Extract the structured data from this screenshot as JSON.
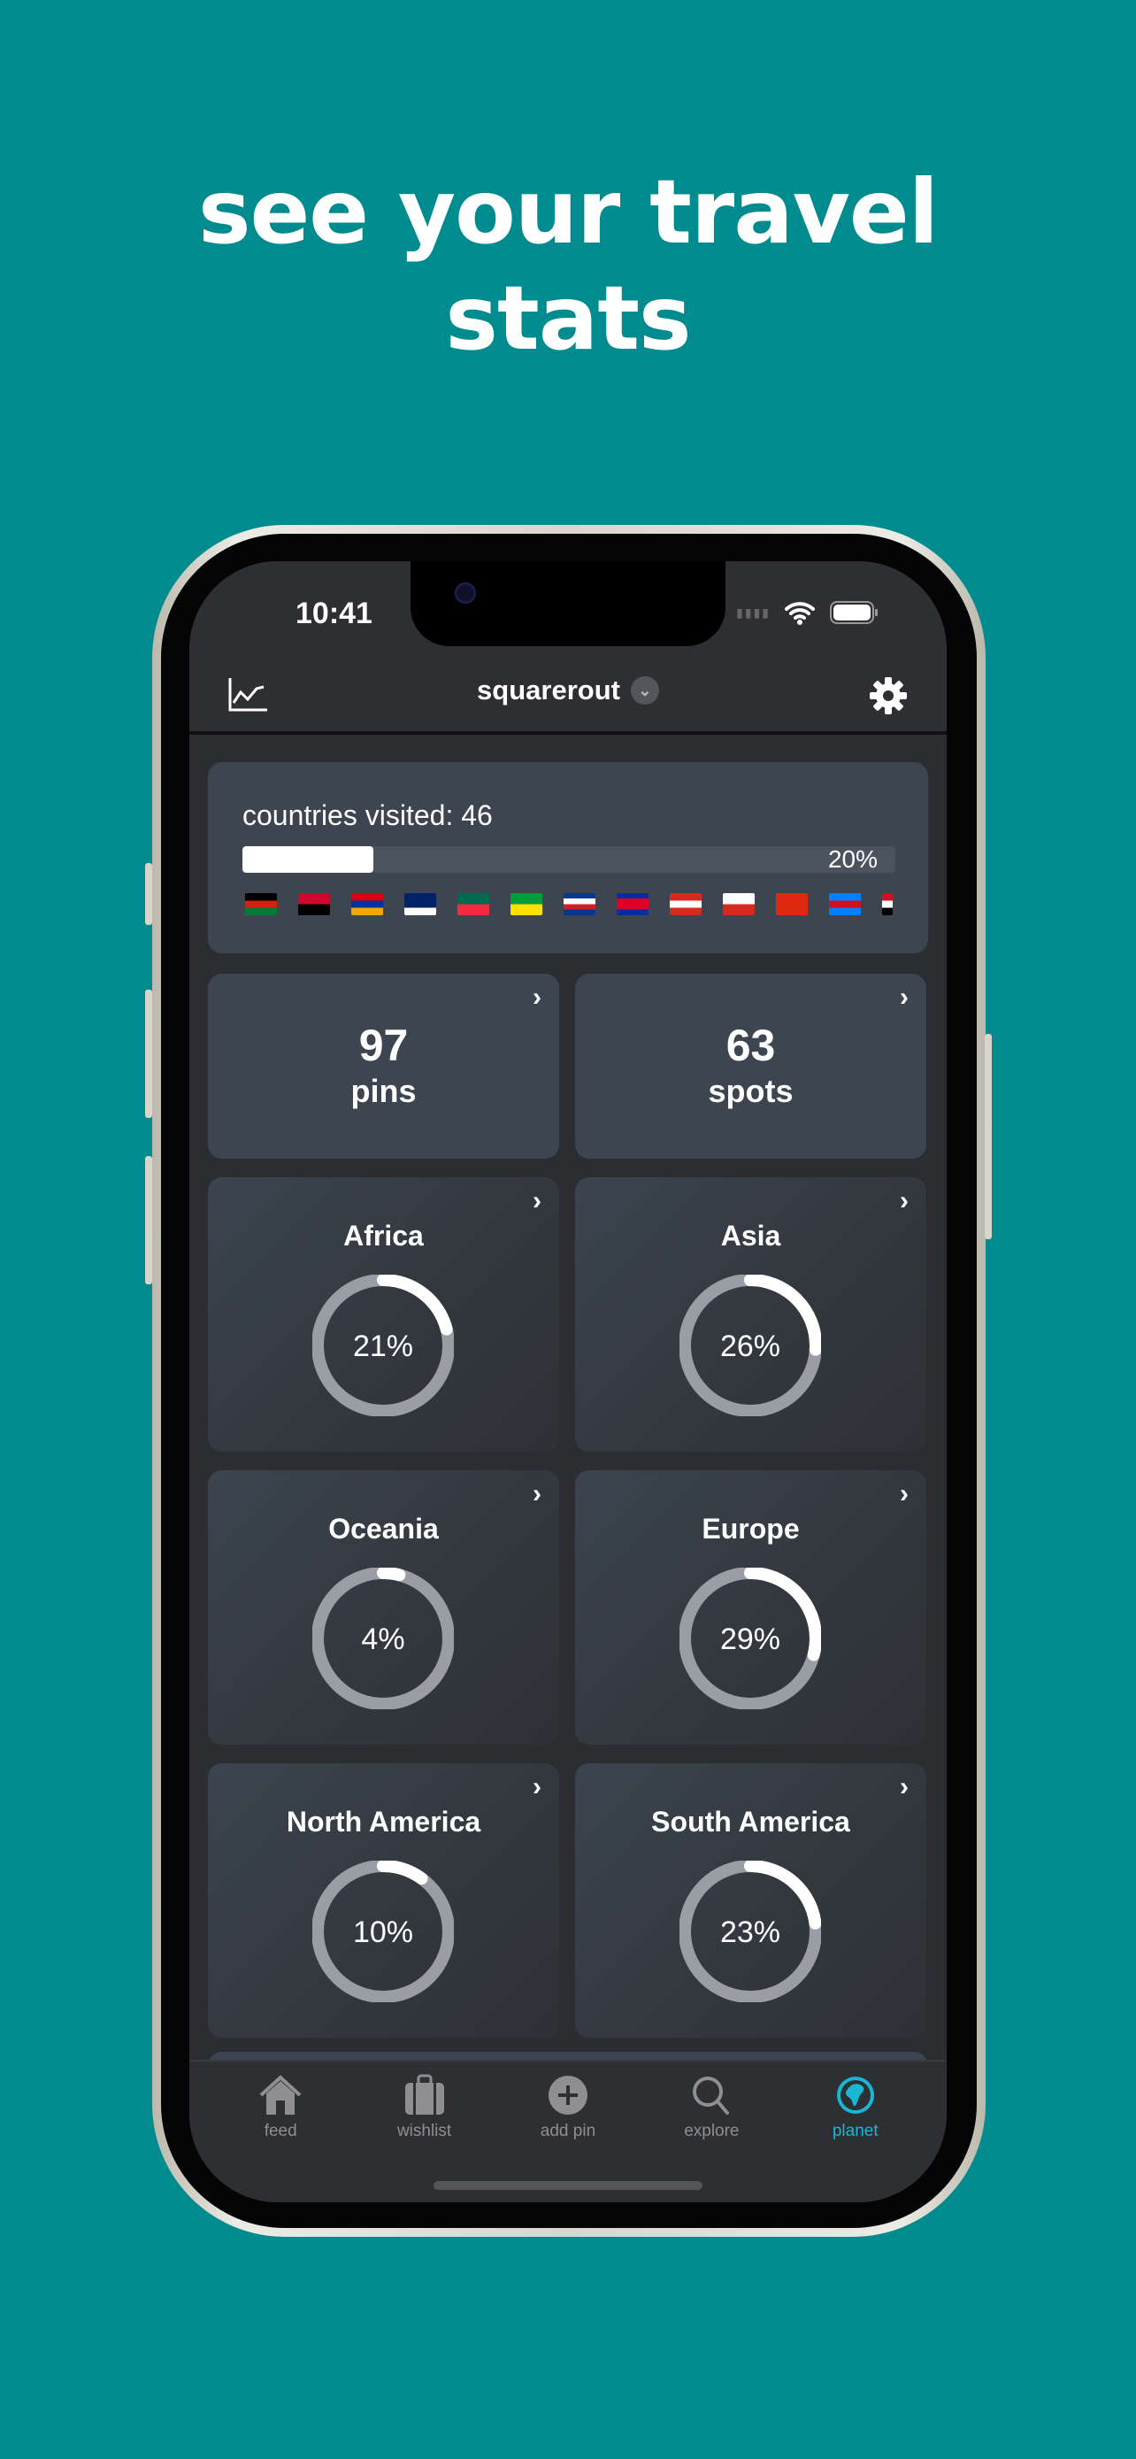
{
  "headline": [
    "see your travel",
    "stats"
  ],
  "status": {
    "time": "10:41"
  },
  "nav": {
    "title": "squarerout",
    "left_icon": "chart-line-icon",
    "right_icon": "gear-icon"
  },
  "countries": {
    "label": "countries visited: 46",
    "progress_percent": 20,
    "progress_label": "20%",
    "flags": [
      {
        "name": "afghanistan",
        "colors": [
          "#000",
          "#d32011",
          "#007a36"
        ]
      },
      {
        "name": "angola",
        "colors": [
          "#cc092f",
          "#000"
        ]
      },
      {
        "name": "armenia",
        "colors": [
          "#d90012",
          "#0033a0",
          "#f2a800"
        ]
      },
      {
        "name": "australia",
        "colors": [
          "#012169",
          "#012169",
          "#fff"
        ]
      },
      {
        "name": "bangladesh",
        "colors": [
          "#006a4e",
          "#f42a41"
        ]
      },
      {
        "name": "brazil",
        "colors": [
          "#009c3b",
          "#ffdf00"
        ]
      },
      {
        "name": "cape-verde",
        "colors": [
          "#003893",
          "#fff",
          "#cf2027",
          "#003893"
        ]
      },
      {
        "name": "cambodia",
        "colors": [
          "#032ea1",
          "#e00025",
          "#e00025",
          "#032ea1"
        ]
      },
      {
        "name": "canada",
        "colors": [
          "#d52b1e",
          "#fff",
          "#d52b1e"
        ]
      },
      {
        "name": "chile",
        "colors": [
          "#fff",
          "#d52b1e"
        ]
      },
      {
        "name": "china",
        "colors": [
          "#de2910",
          "#de2910"
        ]
      },
      {
        "name": "dr-congo",
        "colors": [
          "#007fff",
          "#ce1021",
          "#007fff"
        ]
      },
      {
        "name": "egypt",
        "colors": [
          "#ce1126",
          "#fff",
          "#000"
        ]
      }
    ]
  },
  "stats": [
    {
      "value": "97",
      "label": "pins"
    },
    {
      "value": "63",
      "label": "spots"
    }
  ],
  "continents": [
    {
      "name": "Africa",
      "percent": 21,
      "label": "21%"
    },
    {
      "name": "Asia",
      "percent": 26,
      "label": "26%"
    },
    {
      "name": "Oceania",
      "percent": 4,
      "label": "4%"
    },
    {
      "name": "Europe",
      "percent": 29,
      "label": "29%"
    },
    {
      "name": "North America",
      "percent": 10,
      "label": "10%"
    },
    {
      "name": "South America",
      "percent": 23,
      "label": "23%"
    }
  ],
  "tabs": [
    {
      "label": "feed",
      "icon": "home-icon"
    },
    {
      "label": "wishlist",
      "icon": "suitcase-icon"
    },
    {
      "label": "add pin",
      "icon": "plus-circle-icon"
    },
    {
      "label": "explore",
      "icon": "search-icon"
    },
    {
      "label": "planet",
      "icon": "globe-icon",
      "active": true
    }
  ],
  "colors": {
    "background": "#008b8e",
    "accent": "#19b6d6",
    "card": "#3c4550"
  }
}
